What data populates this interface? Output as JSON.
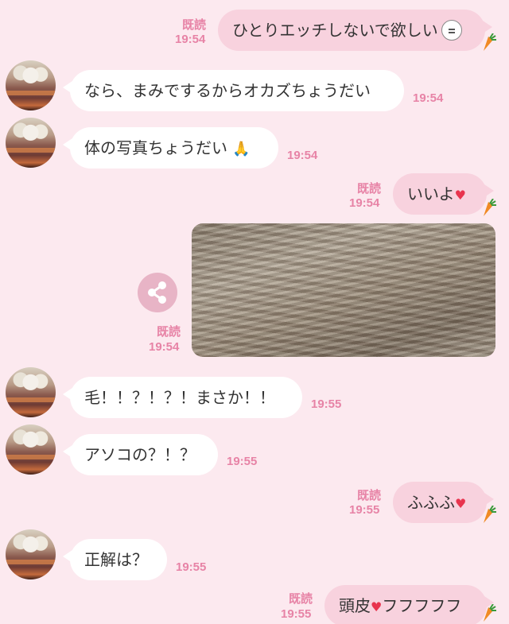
{
  "theme": {
    "background": "#fce9ef",
    "accent": "#e783a6",
    "outgoing_bubble": "#f8d2de",
    "incoming_bubble": "#ffffff"
  },
  "messages": [
    {
      "text": "ひとりエッチしないで欲しい",
      "time": "19:54",
      "read": "既読",
      "emoji": "rabbit-face"
    },
    {
      "text": "なら、まみでするからオカズちょうだい",
      "time": "19:54"
    },
    {
      "text": "体の写真ちょうだい",
      "time": "19:54",
      "emoji": "praying-hands"
    },
    {
      "text": "いいよ",
      "time": "19:54",
      "read": "既読",
      "emoji": "heart"
    },
    {
      "time": "19:54",
      "read": "既読",
      "attachment": "photo"
    },
    {
      "text": "毛！！？！？！まさか！！",
      "time": "19:55"
    },
    {
      "text": "アソコの？！？",
      "time": "19:55"
    },
    {
      "text": "ふふふ",
      "time": "19:55",
      "read": "既読",
      "emoji": "heart"
    },
    {
      "text": "正解は？",
      "time": "19:55"
    },
    {
      "text_before": "頭皮",
      "text_after": "フフフフフ",
      "time": "19:55",
      "read": "既読",
      "emoji": "heart"
    }
  ],
  "icons": {
    "share": "share-icon",
    "carrot": "carrot-icon",
    "heart": "♥"
  }
}
